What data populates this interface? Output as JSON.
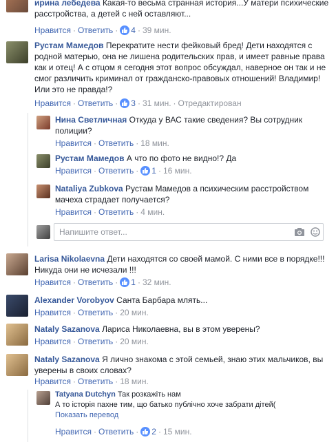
{
  "comments": [
    {
      "name": "ирина лебедева",
      "text": "Какая-то весьма странная история...У матери психические расстройства, а детей с ней оставляют...",
      "like_label": "Нравится",
      "reply_label": "Ответить",
      "likes": "4",
      "time": "39 мин."
    },
    {
      "name": "Рустам Мамедов",
      "text": "Перекратите нести фейковый бред! Дети находятся с родной матерью, она не лишена родительских прав, и имеет равные права как и отец! А с отцом я сегодня этот вопрос обсуждал, наверное он так и не смог различить криминал от гражданско-правовых отношений! Владимир! Или это не правда!?",
      "like_label": "Нравится",
      "reply_label": "Ответить",
      "likes": "3",
      "time": "31 мин.",
      "edited": "Отредактирован"
    },
    {
      "name": "Нина Светличная",
      "text": "Откуда у ВАС такие сведения? Вы сотрудник полиции?",
      "like_label": "Нравится",
      "reply_label": "Ответить",
      "time": "18 мин."
    },
    {
      "name": "Рустам Мамедов",
      "text": "А что по фото не видно!? Да",
      "like_label": "Нравится",
      "reply_label": "Ответить",
      "likes": "1",
      "time": "16 мин."
    },
    {
      "name": "Nataliya Zubkova",
      "text": "Рустам Мамедов а психическим расстройством мачеха страдает получается?",
      "like_label": "Нравится",
      "reply_label": "Ответить",
      "time": "4 мин."
    },
    {
      "name": "Larisa Nikolaevna",
      "text": "Дети находятся со своей мамой. С ними все в порядке!!! Никуда они не исчезали !!!",
      "like_label": "Нравится",
      "reply_label": "Ответить",
      "likes": "1",
      "time": "32 мин."
    },
    {
      "name": "Alexander Vorobyov",
      "text": "Санта Барбара млять...",
      "like_label": "Нравится",
      "reply_label": "Ответить",
      "time": "20 мин."
    },
    {
      "name": "Nataly Sazanova",
      "text": "Лариса Николаевна, вы в этом уверены?",
      "like_label": "Нравится",
      "reply_label": "Ответить",
      "time": "20 мин."
    },
    {
      "name": "Nataly Sazanova",
      "text": "Я лично знакома с этой семьей, знаю этих мальчиков, вы уверены в своих словах?",
      "like_label": "Нравится",
      "reply_label": "Ответить",
      "time": "18 мин."
    },
    {
      "name": "Tatyana Dutchyn",
      "text": "Так розкажіть нам",
      "text2": "А то історія пахне тим, що батько публічно хоче забрати дітей(",
      "translate": "Показать перевод",
      "like_label": "Нравится",
      "reply_label": "Ответить",
      "likes": "2",
      "time": "15 мин."
    }
  ],
  "reply_input": {
    "placeholder": "Напишите ответ..."
  },
  "colors": {
    "link": "#365899",
    "action": "#4267b2",
    "meta": "#90949c",
    "like": "#5890ff"
  },
  "icons": [
    "like-icon",
    "camera-icon",
    "emoji-icon"
  ]
}
